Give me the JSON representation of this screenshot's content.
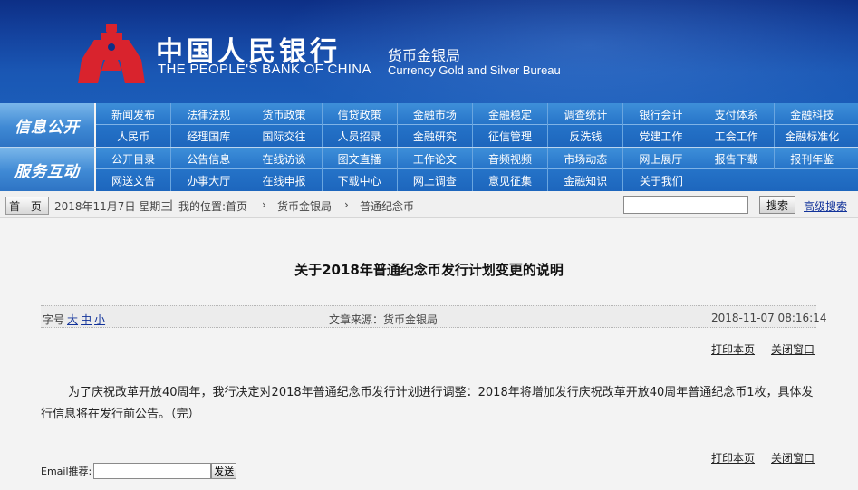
{
  "header": {
    "cn_name": "中国人民银行",
    "en_name": "THE PEOPLE'S BANK OF CHINA",
    "bureau_cn": "货币金银局",
    "bureau_en": "Currency  Gold and Silver Bureau"
  },
  "nav": {
    "section1": {
      "label": "信息公开",
      "row1": [
        "新闻发布",
        "法律法规",
        "货币政策",
        "信贷政策",
        "金融市场",
        "金融稳定",
        "调查统计",
        "银行会计",
        "支付体系",
        "金融科技"
      ],
      "row2": [
        "人民币",
        "经理国库",
        "国际交往",
        "人员招录",
        "金融研究",
        "征信管理",
        "反洗钱",
        "党建工作",
        "工会工作",
        "金融标准化"
      ]
    },
    "section2": {
      "label": "服务互动",
      "row1": [
        "公开目录",
        "公告信息",
        "在线访谈",
        "图文直播",
        "工作论文",
        "音频视频",
        "市场动态",
        "网上展厅",
        "报告下载",
        "报刊年鉴"
      ],
      "row2": [
        "网送文告",
        "办事大厅",
        "在线申报",
        "下载中心",
        "网上调查",
        "意见征集",
        "金融知识",
        "关于我们"
      ]
    }
  },
  "breadcrumb": {
    "home_label": "首 页",
    "date": "2018年11月7日 星期三",
    "sep": "|",
    "location_label": "我的位置:首页",
    "arrow": "›",
    "crumb1": "货币金银局",
    "crumb2": "普通纪念币",
    "search_value": "",
    "search_button": "搜索",
    "advanced_search": "高级搜索"
  },
  "article": {
    "title": "关于2018年普通纪念币发行计划变更的说明",
    "font_label": "字号",
    "size_large": "大",
    "size_medium": "中",
    "size_small": "小",
    "source": "文章来源：货币金银局",
    "datetime": "2018-11-07 08:16:14",
    "print": "打印本页",
    "close": "关闭窗口",
    "body": "为了庆祝改革开放40周年，我行决定对2018年普通纪念币发行计划进行调整：2018年将增加发行庆祝改革开放40周年普通纪念币1枚，具体发行信息将在发行前公告。（完）",
    "email_label": "Email推荐:",
    "email_value": "",
    "send_button": "发送"
  },
  "colors": {
    "header_blue": "#14439f",
    "nav_blue": "#2573c8",
    "link_blue": "#12339a",
    "logo_red": "#d9232d"
  }
}
